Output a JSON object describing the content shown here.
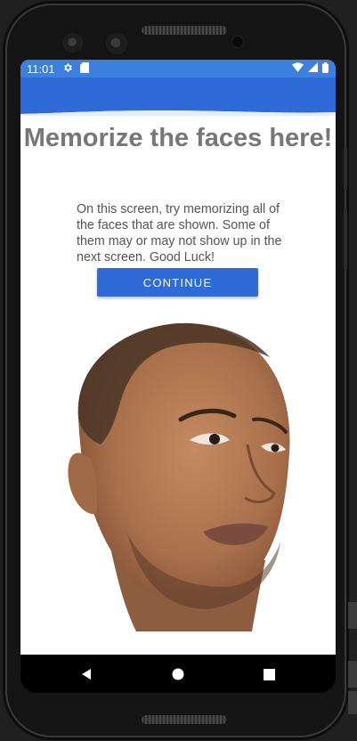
{
  "status_bar": {
    "time": "11:01",
    "left_icons": [
      "gear-icon",
      "sd-card-icon"
    ],
    "right_icons": [
      "wifi-icon",
      "cellular-signal-icon",
      "battery-icon"
    ],
    "color": "#3c7fdd"
  },
  "screen": {
    "title": "Memorize the faces here!",
    "description": "On this screen, try memorizing all of the faces that are shown. Some of them may or may not show up in the next screen. Good Luck!",
    "continue_label": "CONTINUE",
    "face_image": "face-photo-man"
  },
  "nav_bar": {
    "icons": [
      "back-icon",
      "home-icon",
      "recents-icon"
    ]
  },
  "colors": {
    "accent": "#2e6ad8",
    "title": "#777777",
    "body_text": "#555555"
  }
}
